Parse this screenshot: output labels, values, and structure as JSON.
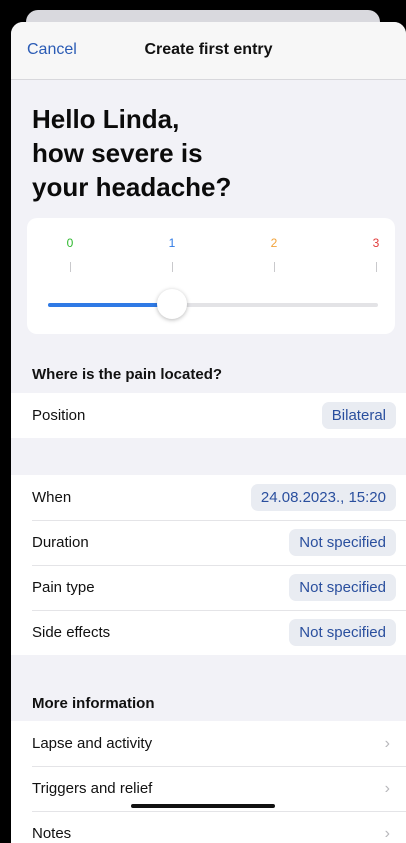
{
  "nav": {
    "cancel": "Cancel",
    "title": "Create first entry"
  },
  "question": [
    "Hello Linda,",
    "how severe is",
    "your headache?"
  ],
  "severity": {
    "ticks": [
      {
        "label": "0",
        "color": "#2eb82e"
      },
      {
        "label": "1",
        "color": "#2f7ae5"
      },
      {
        "label": "2",
        "color": "#f2a33a"
      },
      {
        "label": "3",
        "color": "#e23b3b"
      }
    ],
    "value": 1,
    "max": 3,
    "accent": "#2f7ae5"
  },
  "location": {
    "header": "Where is the pain located?",
    "rows": [
      {
        "label": "Position",
        "value": "Bilateral"
      }
    ]
  },
  "details": {
    "rows": [
      {
        "label": "When",
        "value": "24.08.2023., 15:20"
      },
      {
        "label": "Duration",
        "value": "Not specified"
      },
      {
        "label": "Pain type",
        "value": "Not specified"
      },
      {
        "label": "Side effects",
        "value": "Not specified"
      }
    ]
  },
  "more": {
    "header": "More information",
    "rows": [
      {
        "label": "Lapse and activity",
        "icon": "chevron-right-icon"
      },
      {
        "label": "Triggers and relief",
        "icon": "chevron-right-icon"
      },
      {
        "label": "Notes",
        "icon": "chevron-right-icon"
      }
    ]
  }
}
